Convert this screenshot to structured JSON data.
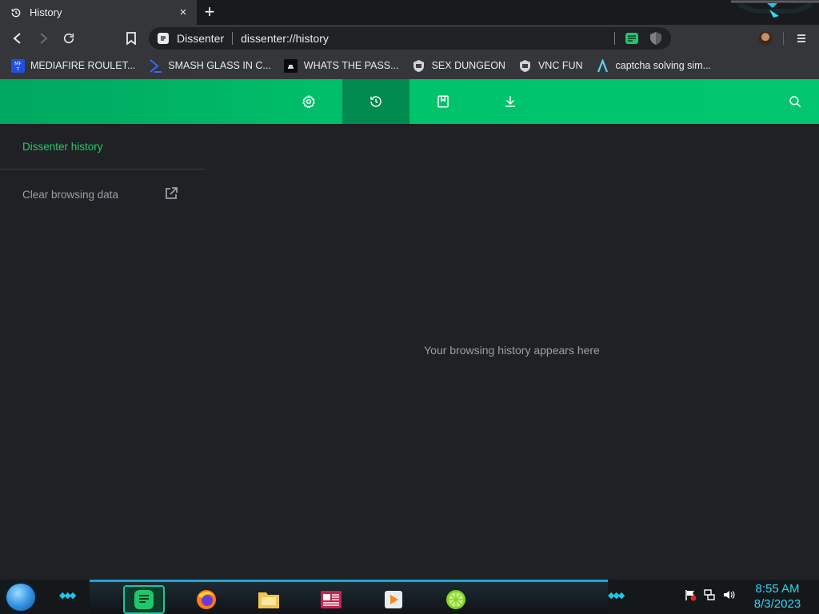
{
  "tab": {
    "title": "History",
    "close": "×",
    "new_tab": "+"
  },
  "omnibox": {
    "site_label": "Dissenter",
    "url": "dissenter://history"
  },
  "bookmarks": [
    {
      "label": "MEDIAFIRE ROULET...",
      "icon": "mediafire-icon"
    },
    {
      "label": "SMASH GLASS IN C...",
      "icon": "chevron-logo-icon"
    },
    {
      "label": "WHATS THE PASS...",
      "icon": "bot-icon"
    },
    {
      "label": "SEX DUNGEON",
      "icon": "shield-badge-icon"
    },
    {
      "label": "VNC FUN",
      "icon": "shield-badge-icon"
    },
    {
      "label": "captcha solving sim...",
      "icon": "lambda-icon"
    }
  ],
  "header": {
    "accent": "#00c46c",
    "active_tab": "history",
    "buttons": [
      "settings",
      "history",
      "bookmarks",
      "downloads",
      "search"
    ]
  },
  "sidebar": {
    "title": "Dissenter history",
    "clear_label": "Clear browsing data"
  },
  "main": {
    "empty_message": "Your browsing history appears here"
  },
  "taskbar": {
    "apps": [
      "dissenter",
      "firefox",
      "file-explorer",
      "news",
      "media-player",
      "lime"
    ],
    "time": "8:55 AM",
    "date": "8/3/2023"
  }
}
